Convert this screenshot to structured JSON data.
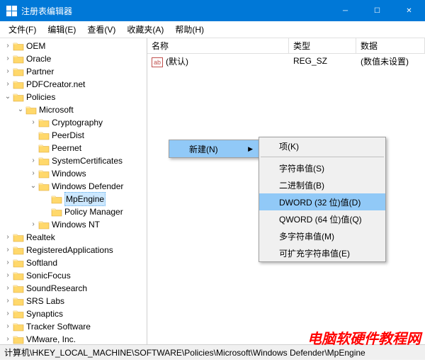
{
  "window": {
    "title": "注册表编辑器"
  },
  "menu": {
    "file": "文件(F)",
    "edit": "编辑(E)",
    "view": "查看(V)",
    "fav": "收藏夹(A)",
    "help": "帮助(H)"
  },
  "tree": [
    {
      "indent": 0,
      "tw": "›",
      "label": "OEM"
    },
    {
      "indent": 0,
      "tw": "›",
      "label": "Oracle"
    },
    {
      "indent": 0,
      "tw": "›",
      "label": "Partner"
    },
    {
      "indent": 0,
      "tw": "›",
      "label": "PDFCreator.net"
    },
    {
      "indent": 0,
      "tw": "⌄",
      "label": "Policies"
    },
    {
      "indent": 1,
      "tw": "⌄",
      "label": "Microsoft"
    },
    {
      "indent": 2,
      "tw": "›",
      "label": "Cryptography"
    },
    {
      "indent": 2,
      "tw": "",
      "label": "PeerDist"
    },
    {
      "indent": 2,
      "tw": "",
      "label": "Peernet"
    },
    {
      "indent": 2,
      "tw": "›",
      "label": "SystemCertificates"
    },
    {
      "indent": 2,
      "tw": "›",
      "label": "Windows"
    },
    {
      "indent": 2,
      "tw": "⌄",
      "label": "Windows Defender"
    },
    {
      "indent": 3,
      "tw": "",
      "label": "MpEngine",
      "selected": true
    },
    {
      "indent": 3,
      "tw": "",
      "label": "Policy Manager"
    },
    {
      "indent": 2,
      "tw": "›",
      "label": "Windows NT"
    },
    {
      "indent": 0,
      "tw": "›",
      "label": "Realtek"
    },
    {
      "indent": 0,
      "tw": "›",
      "label": "RegisteredApplications"
    },
    {
      "indent": 0,
      "tw": "›",
      "label": "Softland"
    },
    {
      "indent": 0,
      "tw": "›",
      "label": "SonicFocus"
    },
    {
      "indent": 0,
      "tw": "›",
      "label": "SoundResearch"
    },
    {
      "indent": 0,
      "tw": "›",
      "label": "SRS Labs"
    },
    {
      "indent": 0,
      "tw": "›",
      "label": "Synaptics"
    },
    {
      "indent": 0,
      "tw": "›",
      "label": "Tracker Software"
    },
    {
      "indent": 0,
      "tw": "›",
      "label": "VMware, Inc."
    }
  ],
  "cols": {
    "name": "名称",
    "type": "类型",
    "data": "数据"
  },
  "row": {
    "name": "(默认)",
    "type": "REG_SZ",
    "data": "(数值未设置)"
  },
  "ctx": {
    "new": "新建(N)"
  },
  "sub": {
    "key": "项(K)",
    "string": "字符串值(S)",
    "binary": "二进制值(B)",
    "dword": "DWORD (32 位)值(D)",
    "qword": "QWORD (64 位)值(Q)",
    "multi": "多字符串值(M)",
    "expand": "可扩充字符串值(E)"
  },
  "status": "计算机\\HKEY_LOCAL_MACHINE\\SOFTWARE\\Policies\\Microsoft\\Windows Defender\\MpEngine",
  "watermark": "电脑软硬件教程网"
}
